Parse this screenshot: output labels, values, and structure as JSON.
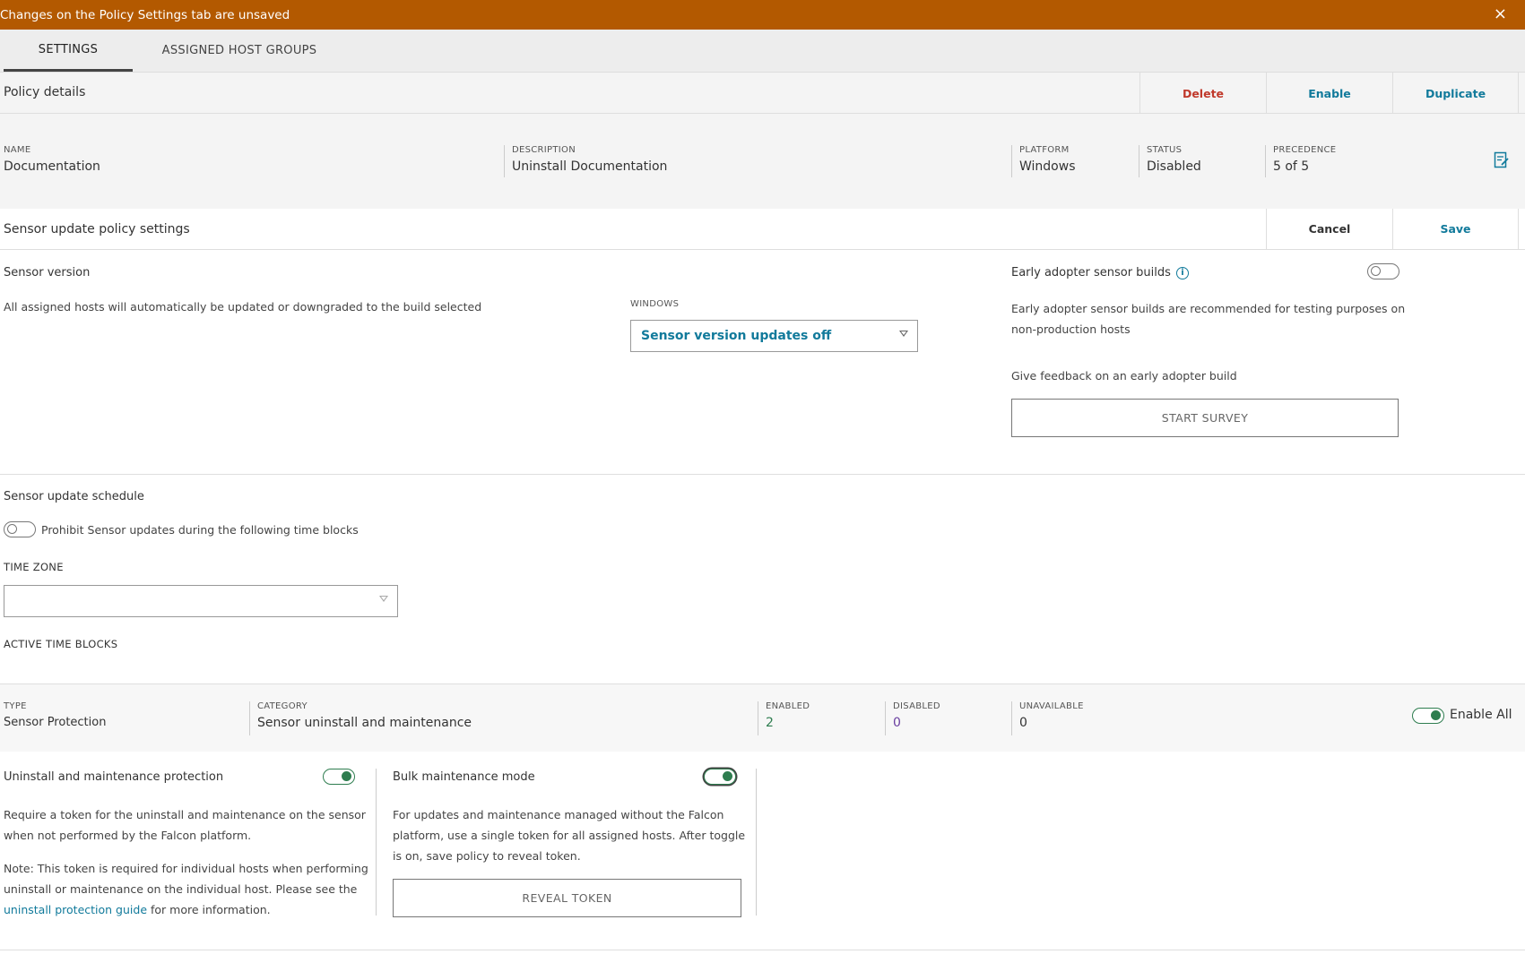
{
  "banner": {
    "message": "Changes on the Policy Settings tab are unsaved",
    "close": "×"
  },
  "tabs": [
    {
      "label": "SETTINGS",
      "active": true
    },
    {
      "label": "ASSIGNED HOST GROUPS",
      "active": false
    }
  ],
  "policy_details": {
    "title": "Policy details",
    "actions": {
      "delete": "Delete",
      "enable": "Enable",
      "duplicate": "Duplicate"
    },
    "fields": {
      "name": {
        "label": "NAME",
        "value": "Documentation"
      },
      "description": {
        "label": "DESCRIPTION",
        "value": "Uninstall Documentation"
      },
      "platform": {
        "label": "PLATFORM",
        "value": "Windows"
      },
      "status": {
        "label": "STATUS",
        "value": "Disabled"
      },
      "precedence": {
        "label": "PRECEDENCE",
        "value": "5 of 5"
      }
    },
    "edit_icon": "edit-icon"
  },
  "sensor_settings": {
    "title": "Sensor update policy settings",
    "actions": {
      "cancel": "Cancel",
      "save": "Save"
    },
    "sensor_version": {
      "heading": "Sensor version",
      "description": "All assigned hosts will automatically be updated or downgraded to the build selected",
      "platform_label": "WINDOWS",
      "selected": "Sensor version updates off"
    },
    "early_adopter": {
      "heading": "Early adopter sensor builds",
      "enabled": false,
      "description_line1": "Early adopter sensor builds are recommended for testing purposes on",
      "description_line2": "non-production hosts",
      "feedback": "Give feedback on an early adopter build",
      "survey_button": "START SURVEY"
    }
  },
  "schedule": {
    "heading": "Sensor update schedule",
    "prohibit_label": "Prohibit Sensor updates during the following time blocks",
    "prohibit_enabled": false,
    "timezone_label": "TIME ZONE",
    "timezone_value": "",
    "active_blocks_label": "ACTIVE TIME BLOCKS"
  },
  "category": {
    "type_label": "TYPE",
    "type_value": "Sensor Protection",
    "category_label": "CATEGORY",
    "category_value": "Sensor uninstall and maintenance",
    "enabled_label": "ENABLED",
    "enabled_value": "2",
    "disabled_label": "DISABLED",
    "disabled_value": "0",
    "unavailable_label": "UNAVAILABLE",
    "unavailable_value": "0",
    "enable_all_label": "Enable All",
    "enable_all": true
  },
  "protection": {
    "uninstall": {
      "heading": "Uninstall and maintenance protection",
      "enabled": true,
      "line1": "Require a token for the uninstall and maintenance on the sensor",
      "line2": "when not performed by the Falcon platform.",
      "note1": "Note: This token is required for individual hosts when performing",
      "note2": "uninstall or maintenance on the individual host. Please see the",
      "link": "uninstall protection guide",
      "note3": " for more information."
    },
    "bulk": {
      "heading": "Bulk maintenance mode",
      "enabled": true,
      "line1": "For updates and maintenance managed without the Falcon",
      "line2": "platform, use a single token for all assigned hosts. After toggle",
      "line3": "is on, save policy to reveal token.",
      "reveal_button": "REVEAL TOKEN"
    }
  },
  "colors": {
    "banner": "#b35900",
    "accent": "#117a9b",
    "danger": "#c0392b",
    "toggle_on": "#2e7d4f"
  }
}
